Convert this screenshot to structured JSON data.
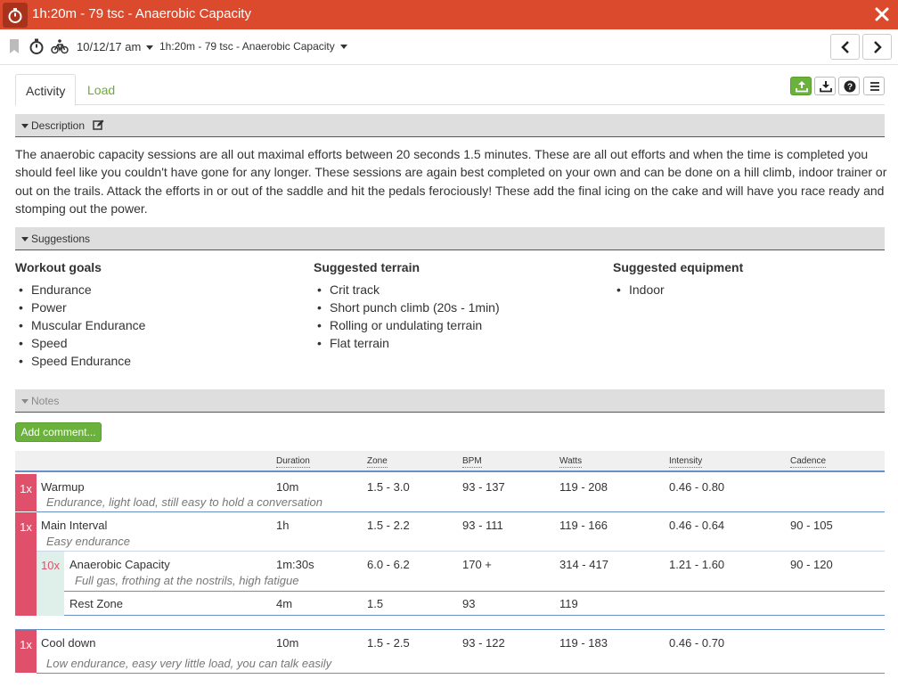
{
  "window": {
    "title": "1h:20m - 79 tsc - Anaerobic Capacity"
  },
  "toolbar": {
    "date": "10/12/17 am",
    "workout_name": "1h:20m - 79 tsc - Anaerobic Capacity"
  },
  "tabs": [
    {
      "label": "Activity"
    },
    {
      "label": "Load"
    }
  ],
  "sections": {
    "description": "Description",
    "suggestions": "Suggestions",
    "notes": "Notes"
  },
  "description_text": "The anaerobic capacity sessions are all out maximal efforts between 20 seconds 1.5 minutes. These are all out efforts and when the time is completed you should feel like you couldn't have gone for any longer. These sessions are again best completed on your own and can be done on a hill climb, indoor trainer or out on the trails. Attack the efforts in or out of the saddle and hit the pedals ferociously! These add the final icing on the cake and will have you race ready and stomping out the power.",
  "suggestions": {
    "goals": {
      "title": "Workout goals",
      "items": [
        "Endurance",
        "Power",
        "Muscular Endurance",
        "Speed",
        "Speed Endurance"
      ]
    },
    "terrain": {
      "title": "Suggested terrain",
      "items": [
        "Crit track",
        "Short punch climb (20s - 1min)",
        "Rolling or undulating terrain",
        "Flat terrain"
      ]
    },
    "equipment": {
      "title": "Suggested equipment",
      "items": [
        "Indoor"
      ]
    }
  },
  "add_comment_label": "Add comment...",
  "workout": {
    "headers": [
      "Duration",
      "Zone",
      "BPM",
      "Watts",
      "Intensity",
      "Cadence"
    ],
    "rows": [
      {
        "rep": "1x",
        "name": "Warmup",
        "desc": "Endurance, light load, still easy to hold a conversation",
        "duration": "10m",
        "zone": "1.5 - 3.0",
        "bpm": "93 - 137",
        "watts": "119 - 208",
        "intensity": "0.46 - 0.80",
        "cadence": ""
      },
      {
        "rep": "1x",
        "name": "Main Interval",
        "desc": "Easy endurance",
        "duration": "1h",
        "zone": "1.5 - 2.2",
        "bpm": "93 - 111",
        "watts": "119 - 166",
        "intensity": "0.46 - 0.64",
        "cadence": "90 - 105"
      },
      {
        "rep": "10x",
        "name": "Anaerobic Capacity",
        "desc": "Full gas, frothing at the nostrils, high fatigue",
        "duration": "1m:30s",
        "zone": "6.0 - 6.2",
        "bpm": "170 +",
        "watts": "314 - 417",
        "intensity": "1.21 - 1.60",
        "cadence": "90 - 120"
      },
      {
        "rep": "",
        "name": "Rest Zone",
        "desc": "",
        "duration": "4m",
        "zone": "1.5",
        "bpm": "93",
        "watts": "119",
        "intensity": "",
        "cadence": ""
      },
      {
        "rep": "1x",
        "name": "Cool down",
        "desc": "Low endurance, easy very little load, you can talk easily",
        "duration": "10m",
        "zone": "1.5 - 2.5",
        "bpm": "93 - 122",
        "watts": "119 - 183",
        "intensity": "0.46 - 0.70",
        "cadence": ""
      }
    ]
  },
  "colors": {
    "title_bar": "#dc4a2e",
    "accent_green": "#6ab23c",
    "rep_pink": "#e0506b",
    "rule_blue": "#6a8fc4"
  }
}
